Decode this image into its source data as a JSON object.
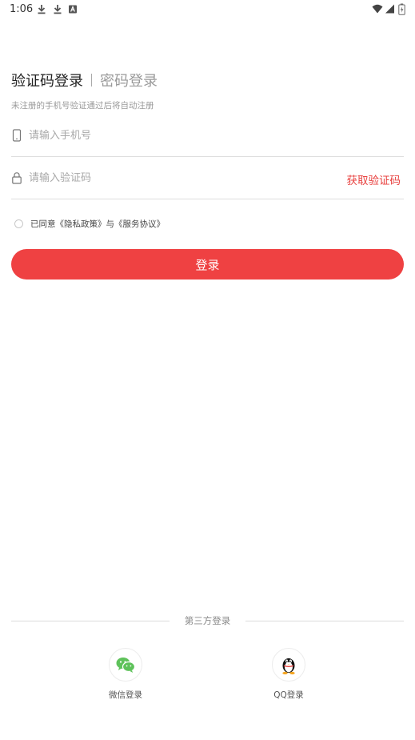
{
  "status_bar": {
    "time": "1:06"
  },
  "tabs": {
    "active": "验证码登录",
    "inactive": "密码登录"
  },
  "hint": "未注册的手机号验证通过后将自动注册",
  "phone_field": {
    "placeholder": "请输入手机号",
    "value": ""
  },
  "code_field": {
    "placeholder": "请输入验证码",
    "value": "",
    "get_code": "获取验证码"
  },
  "agreement": {
    "prefix": "已同意",
    "privacy": "《隐私政策》",
    "joiner": "与",
    "service": "《服务协议》",
    "checked": false
  },
  "login_button": "登录",
  "third_party": {
    "title": "第三方登录",
    "wechat": {
      "label": "微信登录",
      "icon": "wechat-icon",
      "color": "#5ec25a"
    },
    "qq": {
      "label": "QQ登录",
      "icon": "qq-penguin-icon"
    }
  },
  "colors": {
    "accent": "#ef4142",
    "link": "#e8413f"
  }
}
